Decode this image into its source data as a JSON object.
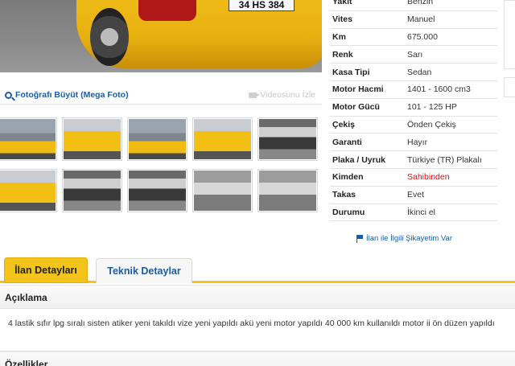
{
  "gallery": {
    "enlarge_label": "Fotoğrafı Büyüt (Mega Foto)",
    "video_label": "Videosunu İzle",
    "plate_text": "34 HS 384"
  },
  "specs": [
    {
      "label": "Yakıt",
      "value": "Benzin"
    },
    {
      "label": "Vites",
      "value": "Manuel"
    },
    {
      "label": "Km",
      "value": "675.000"
    },
    {
      "label": "Renk",
      "value": "Sarı"
    },
    {
      "label": "Kasa Tipi",
      "value": "Sedan"
    },
    {
      "label": "Motor Hacmi",
      "value": "1401 - 1600 cm3"
    },
    {
      "label": "Motor Gücü",
      "value": "101 - 125 HP"
    },
    {
      "label": "Çekiş",
      "value": "Önden Çekiş"
    },
    {
      "label": "Garanti",
      "value": "Hayır"
    },
    {
      "label": "Plaka / Uyruk",
      "value": "Türkiye (TR) Plakalı"
    },
    {
      "label": "Kimden",
      "value": "Sahibinden",
      "highlight": "#e01212"
    },
    {
      "label": "Takas",
      "value": "Evet"
    },
    {
      "label": "Durumu",
      "value": "İkinci el"
    }
  ],
  "complaint_link": "İlan ile İlgili Şikayetim Var",
  "tabs": [
    {
      "label": "İlan Detayları",
      "active": true
    },
    {
      "label": "Teknik Detaylar",
      "active": false
    }
  ],
  "description": {
    "title": "Açıklama",
    "text": "4 lastik sıfır lpg sıralı sisten atiker yeni takıldı vize yeni yapıldı akü yeni motor yapıldı 40  000 km kullanıldı motor ii ön düzen yapıldı"
  },
  "features": {
    "title": "Özellikler"
  },
  "colors": {
    "accent": "#f3c41a",
    "link": "#1a5da6",
    "alert": "#e01212"
  }
}
